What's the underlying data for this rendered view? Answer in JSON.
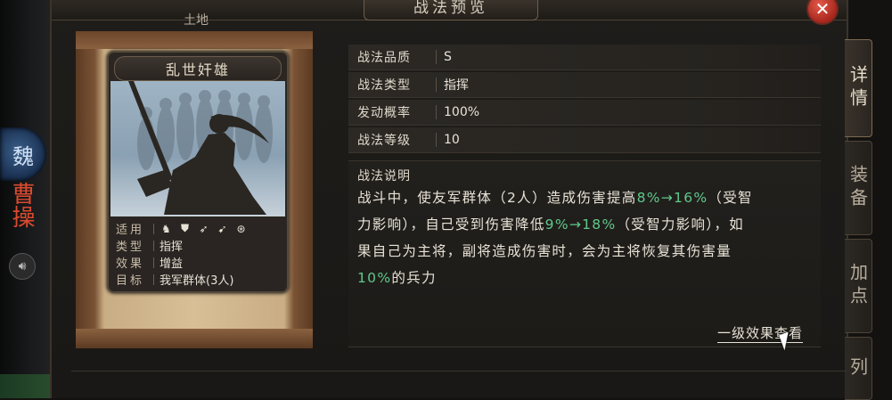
{
  "dialog": {
    "title": "战法预览",
    "sub_tab": "土地",
    "close_label": "✕"
  },
  "background": {
    "faction": "魏",
    "hero_name": "曹操"
  },
  "card": {
    "name": "乱世奸雄",
    "rows": [
      {
        "label": "适用",
        "value": ""
      },
      {
        "label": "类型",
        "value": "指挥"
      },
      {
        "label": "效果",
        "value": "增益"
      },
      {
        "label": "目标",
        "value": "我军群体(3人)"
      }
    ],
    "weapon_icons": [
      "cavalry-icon",
      "shield-icon",
      "bow-icon",
      "spear-icon",
      "siege-icon"
    ]
  },
  "attributes": [
    {
      "label": "战法品质",
      "value": "S"
    },
    {
      "label": "战法类型",
      "value": "指挥"
    },
    {
      "label": "发动概率",
      "value": "100%"
    },
    {
      "label": "战法等级",
      "value": "10"
    }
  ],
  "description": {
    "title": "战法说明",
    "line1_a": "战斗中，使友军群体（2人）造成伤害提高",
    "line1_hl": "8%→16%",
    "line1_b": "（受智",
    "line2_a": "力影响），自己受到伤害降低",
    "line2_hl": "9%→18%",
    "line2_b": "（受智力影响），如",
    "line3": "果自己为主将，副将造成伤害时，会为主将恢复其伤害量",
    "line4_hl": "10%",
    "line4_b": "的兵力"
  },
  "effect_link": "一级效果查看",
  "side_tabs": [
    {
      "label": "详情",
      "active": true
    },
    {
      "label": "装备",
      "active": false
    },
    {
      "label": "加点",
      "active": false
    },
    {
      "label": "列",
      "active": false
    }
  ],
  "colors": {
    "highlight": "#5fc98a",
    "close": "#c0392b"
  }
}
